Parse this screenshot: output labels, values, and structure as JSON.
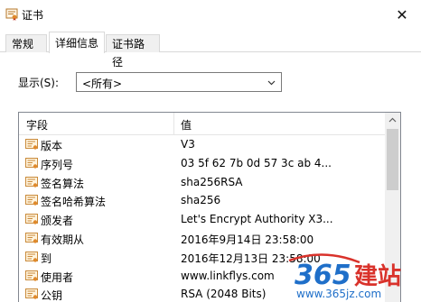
{
  "window": {
    "title": "证书",
    "close_glyph": "✕",
    "title_icon": "certificate-icon"
  },
  "tabs": [
    {
      "label": "常规",
      "active": false
    },
    {
      "label": "详细信息",
      "active": true
    },
    {
      "label": "证书路径",
      "active": false
    }
  ],
  "show": {
    "label": "显示(S):",
    "selected": "<所有>"
  },
  "table": {
    "columns": [
      "字段",
      "值"
    ],
    "rows": [
      {
        "field": "版本",
        "value": "V3"
      },
      {
        "field": "序列号",
        "value": "03 5f 62 7b 0d 57 3c ab 4..."
      },
      {
        "field": "签名算法",
        "value": "sha256RSA"
      },
      {
        "field": "签名哈希算法",
        "value": "sha256"
      },
      {
        "field": "颁发者",
        "value": "Let's Encrypt Authority X3..."
      },
      {
        "field": "有效期从",
        "value": "2016年9月14日 23:58:00"
      },
      {
        "field": "到",
        "value": "2016年12月13日 23:58:00"
      },
      {
        "field": "使用者",
        "value": "www.linkflys.com"
      },
      {
        "field": "公钥",
        "value": "RSA (2048 Bits)"
      }
    ],
    "row_icon": "certificate-field-icon"
  },
  "watermark": {
    "brand_number": "365",
    "brand_chars": "建站",
    "url": "www.365jz.com"
  },
  "colors": {
    "watermark_blue": "#1f6fc9",
    "watermark_red": "#d9322b",
    "icon_orange": "#e08a2c"
  }
}
